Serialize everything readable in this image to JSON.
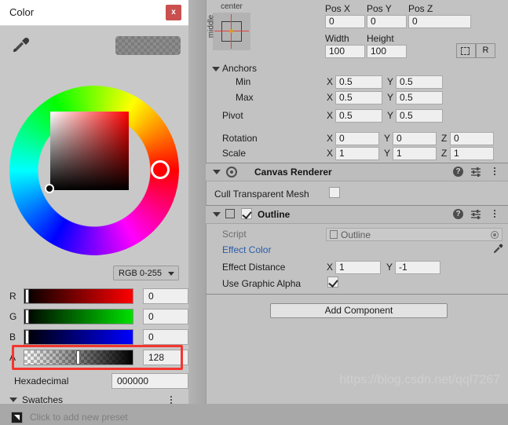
{
  "dialog": {
    "title": "Color",
    "close_label": "x",
    "eyedropper_icon": "eyedropper-icon",
    "preview_swatch_name": "color-preview-swatch",
    "mode_label": "RGB 0-255",
    "channels": [
      {
        "label": "R",
        "value": "0",
        "knob_pct": 0
      },
      {
        "label": "G",
        "value": "0",
        "knob_pct": 0
      },
      {
        "label": "B",
        "value": "0",
        "knob_pct": 0
      },
      {
        "label": "A",
        "value": "128",
        "knob_pct": 50
      }
    ],
    "hex_label": "Hexadecimal",
    "hex_value": "000000",
    "swatches_label": "Swatches",
    "add_preset_label": "Click to add new preset",
    "highlight_color": "#f4352f",
    "close_bg": "#c9504f"
  },
  "inspector": {
    "rect": {
      "anchor_preset": {
        "horizontal": "center",
        "vertical": "middle"
      },
      "pos_labels": [
        "Pos X",
        "Pos Y",
        "Pos Z"
      ],
      "pos_values": [
        "0",
        "0",
        "0"
      ],
      "size_labels": [
        "Width",
        "Height"
      ],
      "size_values": [
        "100",
        "100"
      ],
      "blueprint_icon": "blueprint-mode-icon",
      "raw_label": "R",
      "anchors_label": "Anchors",
      "min_label": "Min",
      "max_label": "Max",
      "pivot_label": "Pivot",
      "min_values": [
        "0.5",
        "0.5"
      ],
      "max_values": [
        "0.5",
        "0.5"
      ],
      "pivot_values": [
        "0.5",
        "0.5"
      ],
      "rotation_label": "Rotation",
      "rotation_values": [
        "0",
        "0",
        "0"
      ],
      "scale_label": "Scale",
      "scale_values": [
        "1",
        "1",
        "1"
      ],
      "axis_x": "X",
      "axis_y": "Y",
      "axis_z": "Z"
    },
    "canvas_renderer": {
      "title": "Canvas Renderer",
      "cull_label": "Cull Transparent Mesh",
      "cull_checked": false
    },
    "outline": {
      "title": "Outline",
      "enabled": true,
      "script_label": "Script",
      "script_value": "Outline",
      "effect_color_label": "Effect Color",
      "effect_color_link": "#2a5ca8",
      "effect_color_value": "#000000",
      "effect_color_alpha_pct": 50,
      "effect_distance_label": "Effect Distance",
      "effect_distance_values": [
        "1",
        "-1"
      ],
      "use_graphic_alpha_label": "Use Graphic Alpha",
      "use_graphic_alpha_checked": true,
      "axis_x": "X",
      "axis_y": "Y"
    },
    "add_component_label": "Add Component",
    "help_icon_label": "?"
  },
  "watermark": "https://blog.csdn.net/qql7267"
}
